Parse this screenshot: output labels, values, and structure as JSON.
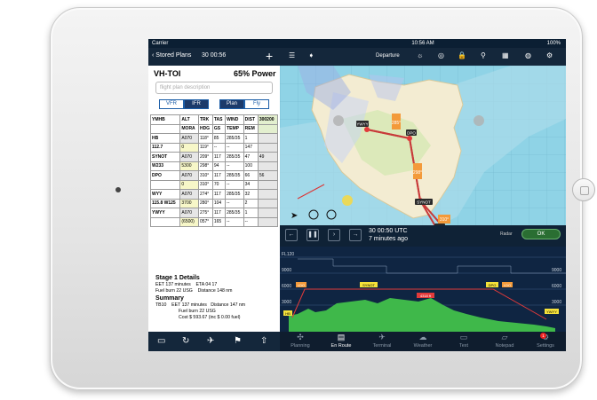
{
  "status_left": {
    "carrier": "Carrier"
  },
  "status_right": {
    "time": "10:56 AM",
    "battery": "100%"
  },
  "nav_left": {
    "back_label": "Stored Plans",
    "timer": "30 00:56",
    "add_label": "+"
  },
  "plan": {
    "registration": "VH-TOI",
    "power": "65% Power",
    "description_placeholder": "flight plan description",
    "rules": [
      "VFR",
      "IFR"
    ],
    "modes": [
      "Plan",
      "Fly"
    ]
  },
  "table": {
    "header1": [
      "YMHB",
      "ALT",
      "TRK",
      "TAS",
      "WIND",
      "DIST",
      "300200"
    ],
    "header2": [
      "",
      "MORA",
      "HDG",
      "GS",
      "TEMP",
      "REM",
      ""
    ],
    "rows": [
      [
        "HB",
        "A070",
        "118°",
        "85",
        "285/35",
        "1",
        ""
      ],
      [
        "112.7",
        "0",
        "119°",
        "--",
        "--",
        "147",
        ""
      ],
      [
        "SYNOT",
        "A070",
        "209°",
        "117",
        "285/35",
        "47",
        "49"
      ],
      [
        "W233",
        "5300",
        "298°",
        "94",
        "--",
        "100",
        ""
      ],
      [
        "DPO",
        "A070",
        "310°",
        "117",
        "285/35",
        "66",
        "56"
      ],
      [
        "",
        "0",
        "310°",
        "70",
        "--",
        "34",
        ""
      ],
      [
        "WYY",
        "A070",
        "274°",
        "117",
        "285/35",
        "32",
        ""
      ],
      [
        "115.8 W125",
        "3700",
        "280°",
        "104",
        "--",
        "2",
        ""
      ],
      [
        "YWYY",
        "A070",
        "275°",
        "117",
        "285/35",
        "1",
        ""
      ],
      [
        "",
        "(6500)",
        "057°",
        "165",
        "--",
        "--",
        ""
      ]
    ]
  },
  "stage": {
    "title": "Stage 1 Details",
    "eet": "EET 137 minutes",
    "eta": "ETA 04 17",
    "fuel": "Fuel burn 22 USG",
    "distance": "Distance 148 nm",
    "summary_title": "Summary",
    "sum_code": "TB10",
    "sum_eet": "EET 137 minutes",
    "sum_distance": "Distance 147 nm",
    "sum_fuel": "Fuel burn 22 USG",
    "sum_cost": "Cost $ 593.67 (inc $ 0.00 fuel)"
  },
  "map": {
    "mode_label": "Departure",
    "waypoints": [
      "YWYY",
      "DPO",
      "SYNOT",
      "HB"
    ],
    "leg_labels": [
      "285°",
      "298°",
      "310°"
    ]
  },
  "info": {
    "utc": "30 00:50 UTC",
    "ago": "7 minutes ago",
    "radar": "Radar",
    "ok": "OK"
  },
  "profile": {
    "fl_label": "FL120",
    "alt_labels_left": [
      "9000",
      "6000",
      "3000"
    ],
    "alt_labels_right": [
      "9000",
      "6000",
      "3000"
    ],
    "waypoints": [
      "LDO",
      "SYNOT",
      "DPO",
      "LDO"
    ],
    "altitude_tag": "4318 ft",
    "end_labels": [
      "HB",
      "YWYY"
    ]
  },
  "tabs": [
    {
      "label": "Planning",
      "icon": "planning-icon"
    },
    {
      "label": "En Route",
      "icon": "en-route-icon"
    },
    {
      "label": "Terminal",
      "icon": "terminal-icon"
    },
    {
      "label": "Weather",
      "icon": "weather-icon"
    },
    {
      "label": "Text",
      "icon": "text-icon"
    },
    {
      "label": "Notepad",
      "icon": "notepad-icon"
    },
    {
      "label": "Settings",
      "icon": "settings-icon"
    }
  ],
  "settings_badge": "1",
  "colors": {
    "nav_bg": "#14273b",
    "accent": "#1c5ea8",
    "route": "#c83a3a",
    "ok": "#2a6e32"
  }
}
